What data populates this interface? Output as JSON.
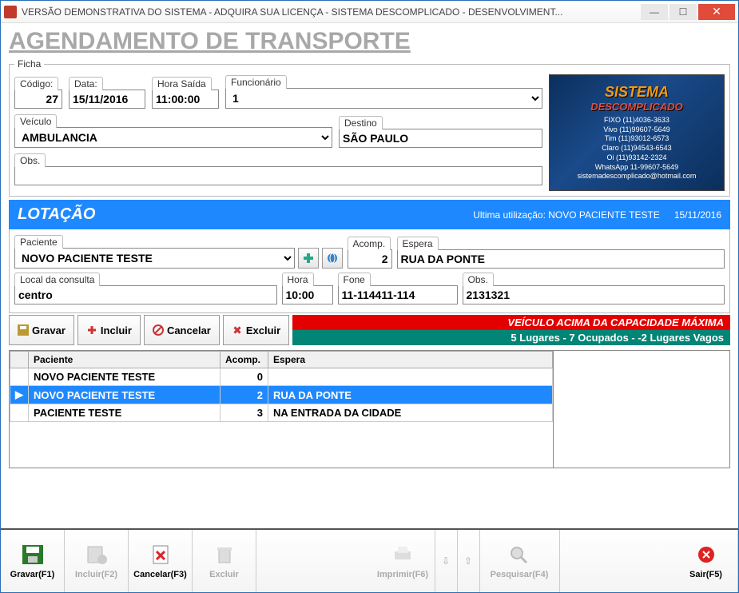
{
  "window": {
    "title": "VERSÃO DEMONSTRATIVA DO SISTEMA - ADQUIRA SUA LICENÇA - SISTEMA DESCOMPLICADO - DESENVOLVIMENT..."
  },
  "page": {
    "title": "AGENDAMENTO DE TRANSPORTE"
  },
  "ficha": {
    "legend": "Ficha",
    "codigo_label": "Código:",
    "codigo": "27",
    "data_label": "Data:",
    "data": "15/11/2016",
    "hora_saida_label": "Hora Saída",
    "hora_saida": "11:00:00",
    "funcionario_label": "Funcionário",
    "funcionario": "1",
    "veiculo_label": "Veículo",
    "veiculo": "AMBULANCIA",
    "destino_label": "Destino",
    "destino": "SÃO PAULO",
    "obs_label": "Obs.",
    "obs": ""
  },
  "brand": {
    "name1": "SISTEMA",
    "name2": "DESCOMPLICADO",
    "contacts": [
      "FIXO (11)4036-3633",
      "Vivo (11)99607-5649",
      "Tim (11)93012-6573",
      "Claro (11)94543-6543",
      "Oi (11)93142-2324",
      "WhatsApp 11-99607-5649",
      "sistemadescomplicado@hotmail.com"
    ]
  },
  "lotacao": {
    "title": "LOTAÇÃO",
    "ultima_label": "Ultima utilização: NOVO PACIENTE TESTE",
    "ultima_data": "15/11/2016",
    "paciente_label": "Paciente",
    "paciente": "NOVO PACIENTE TESTE",
    "acomp_label": "Acomp.",
    "acomp": "2",
    "espera_label": "Espera",
    "espera": "RUA DA PONTE",
    "local_label": "Local da consulta",
    "local": "centro",
    "hora_label": "Hora",
    "hora": "10:00",
    "fone_label": "Fone",
    "fone": "11-114411-114",
    "obs_label": "Obs.",
    "obs": "2131321"
  },
  "toolbar": {
    "gravar": "Gravar",
    "incluir": "Incluir",
    "cancelar": "Cancelar",
    "excluir": "Excluir"
  },
  "status": {
    "over_capacity": "VEÍCULO ACIMA DA CAPACIDADE MÁXIMA",
    "summary": "5 Lugares  -  7 Ocupados  -  -2 Lugares Vagos"
  },
  "grid": {
    "headers": {
      "paciente": "Paciente",
      "acomp": "Acomp.",
      "espera": "Espera"
    },
    "rows": [
      {
        "paciente": "NOVO PACIENTE TESTE",
        "acomp": 0,
        "espera": "",
        "selected": false,
        "current": false
      },
      {
        "paciente": "NOVO PACIENTE TESTE",
        "acomp": 2,
        "espera": "RUA DA PONTE",
        "selected": true,
        "current": true
      },
      {
        "paciente": "PACIENTE TESTE",
        "acomp": 3,
        "espera": "NA ENTRADA DA CIDADE",
        "selected": false,
        "current": false
      }
    ]
  },
  "bottom": {
    "gravar": "Gravar(F1)",
    "incluir": "Incluir(F2)",
    "cancelar": "Cancelar(F3)",
    "excluir": "Excluir",
    "imprimir": "Imprimir(F6)",
    "pesquisar": "Pesquisar(F4)",
    "sair": "Sair(F5)"
  }
}
